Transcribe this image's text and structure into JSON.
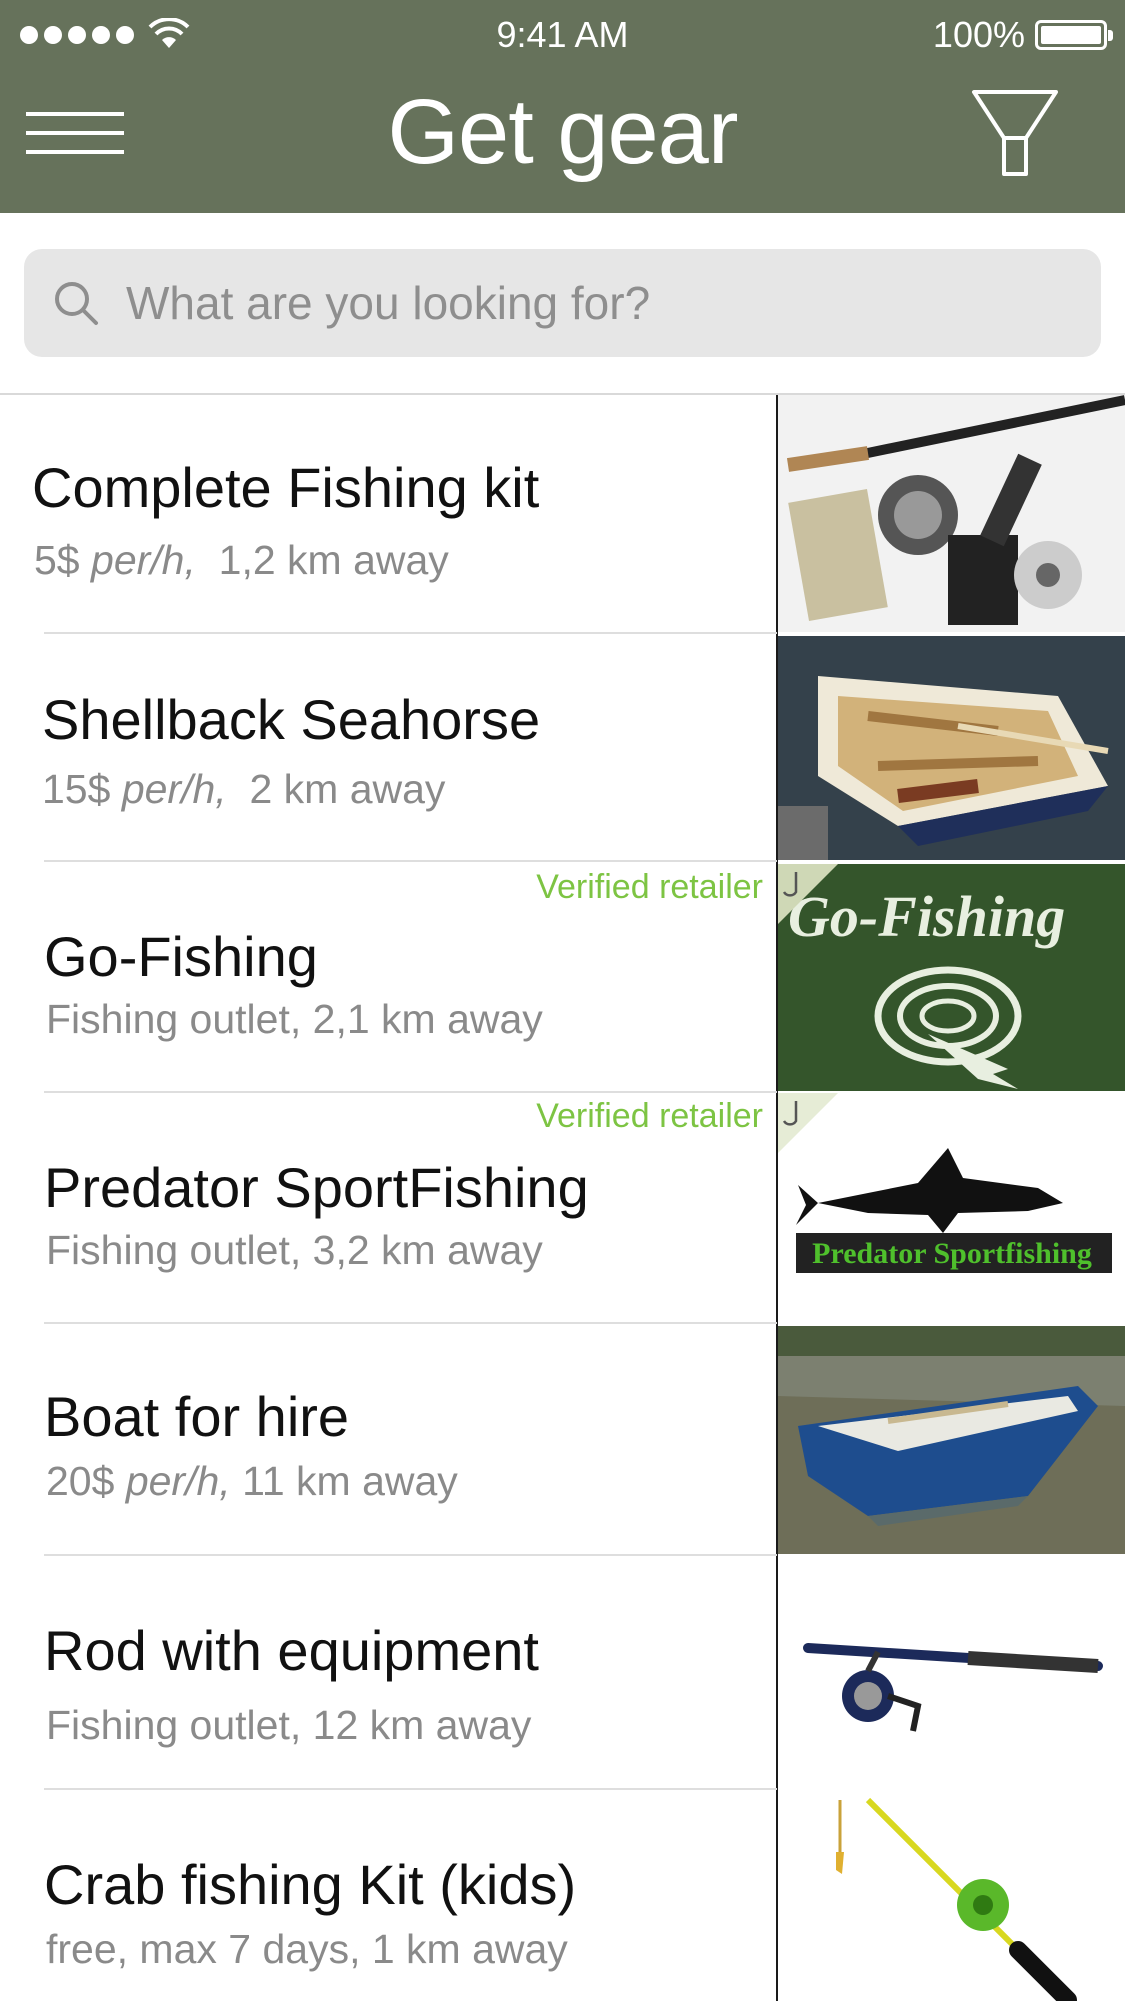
{
  "status_bar": {
    "time": "9:41 AM",
    "battery": "100%"
  },
  "header": {
    "title": "Get gear"
  },
  "search": {
    "placeholder": "What are you looking for?"
  },
  "items": [
    {
      "title": "Complete Fishing kit",
      "price": "5$",
      "unit": "per/h,",
      "distance": "1,2 km away",
      "image": "fishing-kit-photo"
    },
    {
      "title": "Shellback Seahorse",
      "price": "15$",
      "unit": "per/h,",
      "distance": "2 km away",
      "image": "rowboat-photo"
    },
    {
      "title": "Go-Fishing",
      "subtitle": "Fishing outlet, 2,1 km away",
      "verified": "Verified retailer",
      "image": "go-fishing-logo",
      "logo_text": "Go-Fishing"
    },
    {
      "title": "Predator SportFishing",
      "subtitle": "Fishing outlet, 3,2 km away",
      "verified": "Verified retailer",
      "image": "predator-logo",
      "logo_text": "Predator Sportfishing"
    },
    {
      "title": "Boat for hire",
      "price": "20$",
      "unit": "per/h,",
      "distance": "11 km away",
      "image": "blue-boat-photo"
    },
    {
      "title": "Rod with equipment",
      "subtitle": "Fishing outlet, 12 km away",
      "image": "rod-photo"
    },
    {
      "title": "Crab fishing Kit (kids)",
      "subtitle": "free, max 7 days,  1 km away",
      "image": "kids-rod-photo"
    }
  ],
  "colors": {
    "header_bg": "#66725b",
    "verified": "#7dc443",
    "logo_green": "#34552b"
  }
}
